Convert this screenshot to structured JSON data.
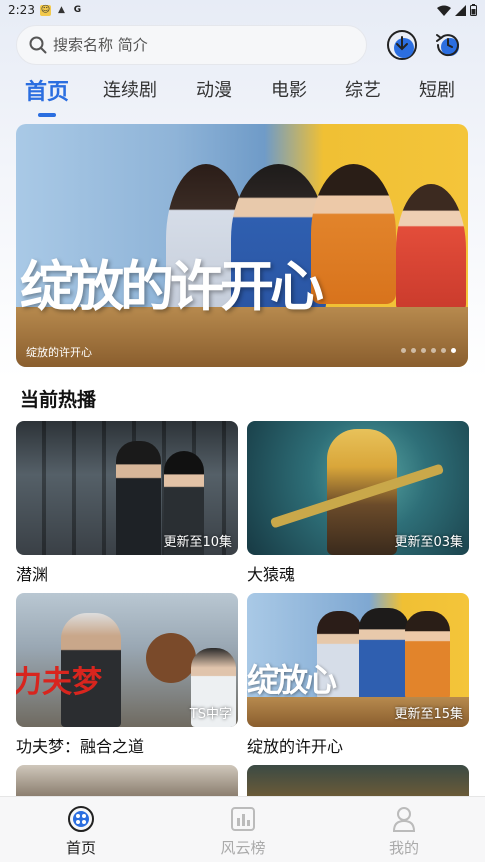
{
  "status": {
    "time": "2:23",
    "g": "G"
  },
  "search": {
    "placeholder": "搜索名称 简介"
  },
  "tabs": [
    "首页",
    "连续剧",
    "动漫",
    "电影",
    "综艺",
    "短剧"
  ],
  "banner": {
    "calligraphy": "绽放的许开心",
    "caption": "绽放的许开心"
  },
  "section": {
    "title": "当前热播"
  },
  "cards": [
    {
      "title": "潜渊",
      "badge": "更新至10集"
    },
    {
      "title": "大猿魂",
      "badge": "更新至03集"
    },
    {
      "title": "功夫梦：融合之道",
      "badge": "TS中字"
    },
    {
      "title": "绽放的许开心",
      "badge": "更新至15集"
    }
  ],
  "nav": [
    {
      "label": "首页",
      "icon": "home-icon"
    },
    {
      "label": "风云榜",
      "icon": "chart-icon"
    },
    {
      "label": "我的",
      "icon": "profile-icon"
    }
  ],
  "colors": {
    "accent": "#2b6ee0"
  }
}
